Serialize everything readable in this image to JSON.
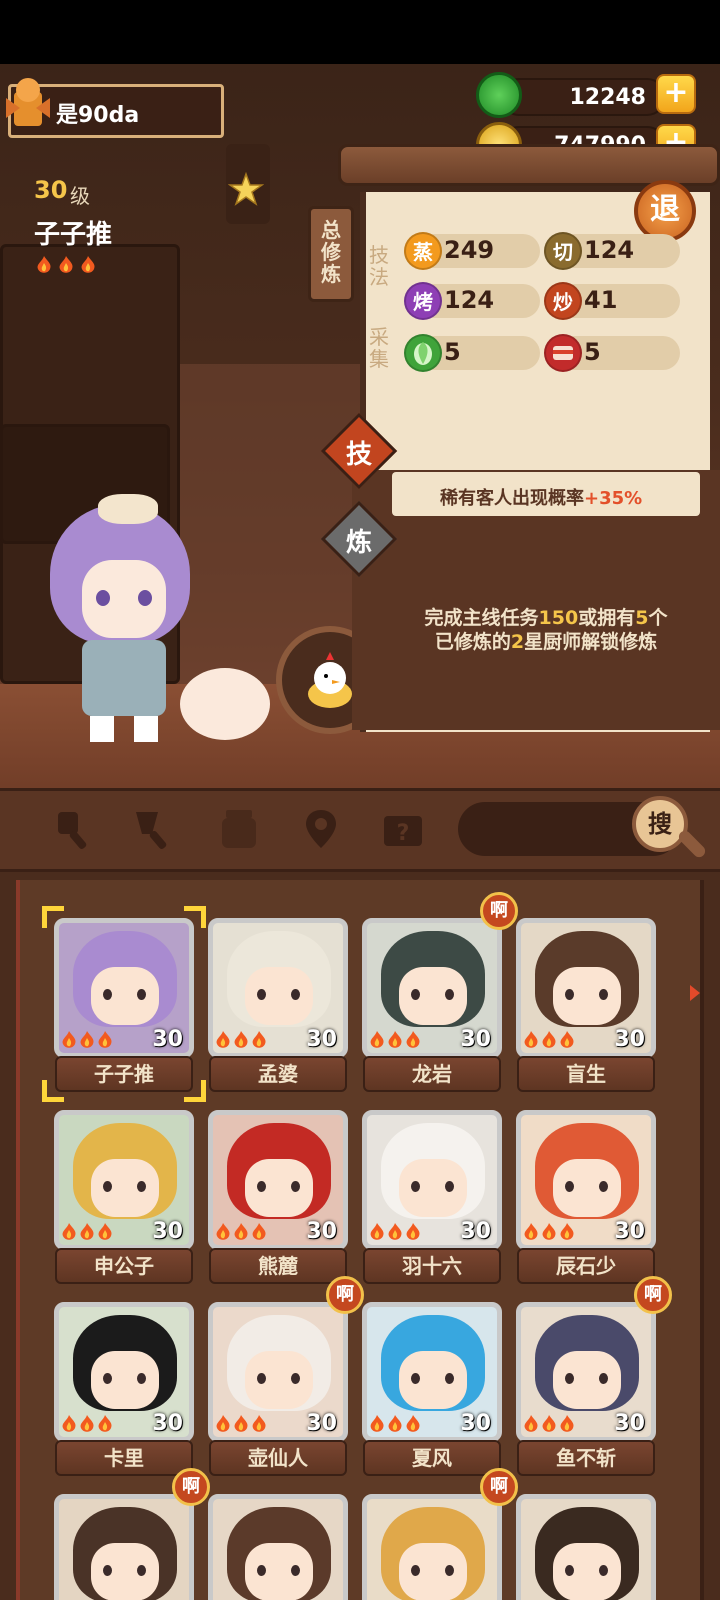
{
  "player": {
    "name": "是90da"
  },
  "chef": {
    "level": "30",
    "level_unit": "级",
    "name": "子子推"
  },
  "currency": {
    "jade": {
      "value": "12248",
      "add_label": "+"
    },
    "coins": {
      "value": "747990",
      "add_label": "+"
    }
  },
  "panel": {
    "title": "总修炼",
    "exit_label": "退",
    "skills_label": "技法",
    "gather_label": "采集",
    "stats": [
      {
        "icon": "蒸",
        "value": "249",
        "color": "#f39a1e"
      },
      {
        "icon": "切",
        "value": "124",
        "color": "#8a6b2e"
      },
      {
        "icon": "烤",
        "value": "124",
        "color": "#8e3fb5"
      },
      {
        "icon": "炒",
        "value": "41",
        "color": "#c2451f"
      },
      {
        "icon": "veg",
        "value": "5",
        "color": "#3fa33a"
      },
      {
        "icon": "meat",
        "value": "5",
        "color": "#c22b2b"
      }
    ],
    "tab_skill": "技",
    "tab_train": "炼",
    "rare_text_prefix": "稀有客人出现概率",
    "rare_text_value": "+35%",
    "unlock_line1_a": "完成主线任务",
    "unlock_line1_b": "150",
    "unlock_line1_c": "或拥有",
    "unlock_line1_d": "5",
    "unlock_line1_e": "个",
    "unlock_line2_a": "已修炼的",
    "unlock_line2_b": "2",
    "unlock_line2_c": "星厨师解锁修炼"
  },
  "search": {
    "button_label": "搜"
  },
  "badge_label": "啊",
  "chefs": [
    {
      "name": "子子推",
      "level": "30",
      "bg": "#b6a1c9",
      "hair": "#a98bd0",
      "badge": false
    },
    {
      "name": "孟婆",
      "level": "30",
      "bg": "#e5e0d3",
      "hair": "#ece7da",
      "badge": false
    },
    {
      "name": "龙岩",
      "level": "30",
      "bg": "#d5d8cf",
      "hair": "#3d4a45",
      "badge": true
    },
    {
      "name": "盲生",
      "level": "30",
      "bg": "#e4d8c6",
      "hair": "#5a3b2a",
      "badge": false
    },
    {
      "name": "申公子",
      "level": "30",
      "bg": "#c9d8c0",
      "hair": "#e3b54a",
      "badge": false
    },
    {
      "name": "熊麓",
      "level": "30",
      "bg": "#e4c2b4",
      "hair": "#c32a24",
      "badge": false
    },
    {
      "name": "羽十六",
      "level": "30",
      "bg": "#e7e3dd",
      "hair": "#f5f2ee",
      "badge": false
    },
    {
      "name": "辰石少",
      "level": "30",
      "bg": "#f0dcc7",
      "hair": "#e05a35",
      "badge": false
    },
    {
      "name": "卡里",
      "level": "30",
      "bg": "#d7e0cd",
      "hair": "#1b1b1b",
      "badge": false
    },
    {
      "name": "壶仙人",
      "level": "30",
      "bg": "#ebd9cb",
      "hair": "#f2ece6",
      "badge": true
    },
    {
      "name": "夏风",
      "level": "30",
      "bg": "#d7e6ec",
      "hair": "#38a7df",
      "badge": false
    },
    {
      "name": "鱼不斩",
      "level": "30",
      "bg": "#e8dccd",
      "hair": "#4a4a6a",
      "badge": true
    },
    {
      "name": "",
      "level": "",
      "bg": "#e4d5c2",
      "hair": "#4a3327",
      "badge": true
    },
    {
      "name": "",
      "level": "",
      "bg": "#e6d7c6",
      "hair": "#5b3a2a",
      "badge": false
    },
    {
      "name": "",
      "level": "",
      "bg": "#e9dcc8",
      "hair": "#e0a84a",
      "badge": true
    },
    {
      "name": "",
      "level": "",
      "bg": "#e6d9c7",
      "hair": "#3a2a20",
      "badge": false
    }
  ]
}
